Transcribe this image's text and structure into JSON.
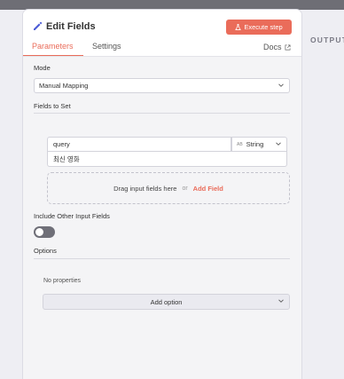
{
  "output_panel": {
    "label": "OUTPUT"
  },
  "header": {
    "title": "Edit Fields",
    "title_icon": "pencil-icon",
    "execute_label": "Execute step",
    "execute_icon": "flask-icon",
    "tabs": [
      {
        "label": "Parameters",
        "active": true
      },
      {
        "label": "Settings",
        "active": false
      }
    ],
    "docs_label": "Docs",
    "docs_icon": "external-link-icon"
  },
  "mode": {
    "label": "Mode",
    "value": "Manual Mapping"
  },
  "fields": {
    "label": "Fields to Set",
    "items": [
      {
        "name": "query",
        "type_prefix": "AB",
        "type": "String",
        "value": "최신 영화"
      }
    ]
  },
  "dropzone": {
    "text": "Drag input fields here",
    "or": "or",
    "add_label": "Add Field"
  },
  "include_other": {
    "label": "Include Other Input Fields",
    "enabled": false
  },
  "options": {
    "label": "Options",
    "empty_text": "No properties",
    "add_label": "Add option"
  },
  "colors": {
    "accent": "#ea6c5a",
    "toggle_off": "#6f6f78"
  }
}
